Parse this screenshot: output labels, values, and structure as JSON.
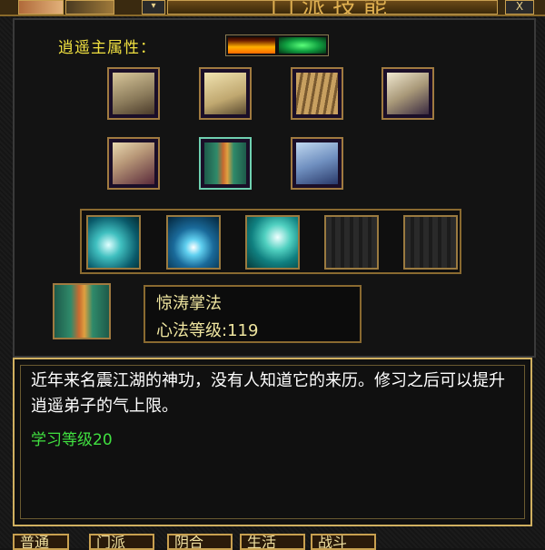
{
  "window": {
    "title": "门派技能",
    "close": "X",
    "dropdown": "▾"
  },
  "school": {
    "attribute_label": "逍遥主属性：",
    "elements": [
      "fire",
      "wood"
    ]
  },
  "skills_grid": [
    {
      "icon": "book-stack-icon"
    },
    {
      "icon": "book-icon"
    },
    {
      "icon": "scroll-bundle-icon"
    },
    {
      "icon": "scroll-icon"
    },
    {
      "icon": "scroll-icon"
    },
    {
      "icon": "gift-box-icon",
      "selected": true
    },
    {
      "icon": "blue-scroll-icon"
    }
  ],
  "buff_slots": [
    {
      "icon": "wave-icon"
    },
    {
      "icon": "diver-icon"
    },
    {
      "icon": "wave-icon"
    },
    {
      "icon": "empty-slot-icon"
    },
    {
      "icon": "empty-slot-icon"
    }
  ],
  "current_skill": {
    "name": "惊涛掌法",
    "level_text": "心法等级:119"
  },
  "description": {
    "text": "近年来名震江湖的神功，没有人知道它的来历。修习之后可以提升逍遥弟子的气上限。",
    "requirement": "学习等级20"
  },
  "tabs": [
    {
      "label": "普通"
    },
    {
      "label": "门派"
    },
    {
      "label": "阴合"
    },
    {
      "label": "生活"
    },
    {
      "label": "战斗"
    }
  ],
  "colors": {
    "accent_gold": "#c8a050",
    "attr_yellow": "#f0e040",
    "req_green": "#40e040"
  }
}
